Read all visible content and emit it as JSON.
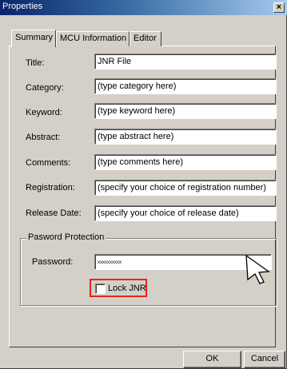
{
  "window": {
    "title": "Properties",
    "close_label": "×"
  },
  "tabs": [
    {
      "label": "Summary",
      "active": true
    },
    {
      "label": "MCU Information",
      "active": false
    },
    {
      "label": "Editor",
      "active": false
    }
  ],
  "fields": {
    "title": {
      "label": "Title:",
      "value": "JNR File"
    },
    "category": {
      "label": "Category:",
      "value": "(type category here)"
    },
    "keyword": {
      "label": "Keyword:",
      "value": "(type keyword here)"
    },
    "abstract": {
      "label": "Abstract:",
      "value": "(type abstract here)"
    },
    "comments": {
      "label": "Comments:",
      "value": "(type comments here)"
    },
    "registration": {
      "label": "Registration:",
      "value": "(specify your choice of registration number)"
    },
    "release_date": {
      "label": "Release Date:",
      "value": "(specify your choice of release date)"
    }
  },
  "password_group": {
    "title": "Pasword Protection",
    "password_label": "Password:",
    "password_value": "xxxxxxxxxx",
    "lock_label": "Lock JNR",
    "lock_checked": false,
    "highlight_color": "#e8241e"
  },
  "buttons": {
    "ok": "OK",
    "cancel": "Cancel"
  },
  "icons": {
    "cursor": "mouse-pointer-icon",
    "close": "close-icon"
  }
}
